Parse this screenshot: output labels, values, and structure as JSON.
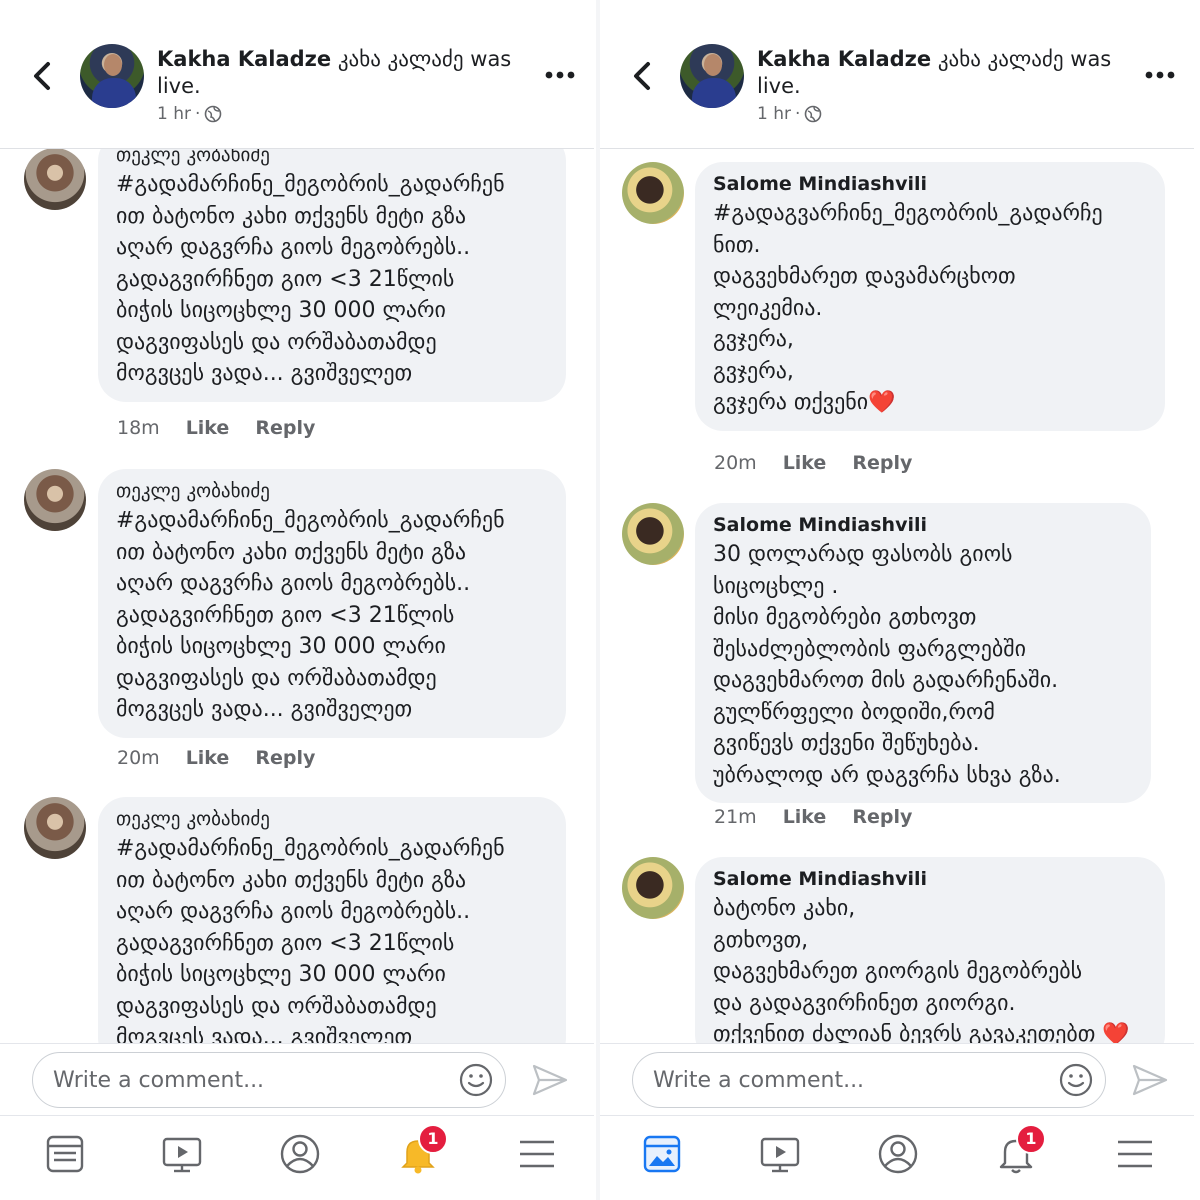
{
  "header": {
    "page_name": "Kakha Kaladze",
    "page_name_alt": "კახა კალაძე",
    "status": "was live.",
    "time": "1 hr",
    "separator": "·"
  },
  "left_comments": [
    {
      "author": "თეკლე კობახიძე",
      "text": "#გადამარჩინე_მეგობრის_გადარჩენ\nით ბატონო კახი თქვენს მეტი გზა\nაღარ დაგვრჩა გიოს მეგობრებს..\nგადაგვირჩნეთ გიო <3 21წლის\nბიჭის სიცოცხლე 30 000 ლარი\nდაგვიფასეს და ორშაბათამდე\nმოგვცეს ვადა... გვიშველეთ",
      "time": "18m",
      "like": "Like",
      "reply": "Reply"
    },
    {
      "author": "თეკლე კობახიძე",
      "text": "#გადამარჩინე_მეგობრის_გადარჩენ\nით ბატონო კახი თქვენს მეტი გზა\nაღარ დაგვრჩა გიოს მეგობრებს..\nგადაგვირჩნეთ გიო <3 21წლის\nბიჭის სიცოცხლე 30 000 ლარი\nდაგვიფასეს და ორშაბათამდე\nმოგვცეს ვადა... გვიშველეთ",
      "time": "20m",
      "like": "Like",
      "reply": "Reply"
    },
    {
      "author": "თეკლე კობახიძე",
      "text": "#გადამარჩინე_მეგობრის_გადარჩენ\nით ბატონო კახი თქვენს მეტი გზა\nაღარ დაგვრჩა გიოს მეგობრებს..\nგადაგვირჩნეთ გიო <3 21წლის\nბიჭის სიცოცხლე 30 000 ლარი\nდაგვიფასეს და ორშაბათამდე\nმოგვცეს ვადა... გვიშველეთ"
    }
  ],
  "right_comments": [
    {
      "author": "Salome Mindiashvili",
      "text": "#გადაგვარჩინე_მეგობრის_გადარჩე\nნით.\nდაგვეხმარეთ დავამარცხოთ\nლეიკემია.\nგვჯერა,\nგვჯერა,\nგვჯერა თქვენი❤️",
      "time": "20m",
      "like": "Like",
      "reply": "Reply"
    },
    {
      "author": "Salome Mindiashvili",
      "text": "30 დოლარად ფასობს გიოს\nსიცოცხლე .\nმისი მეგობრები გთხოვთ\nშესაძლებლობის ფარგლებში\nდაგვეხმაროთ მის გადარჩენაში.\nგულწრფელი ბოდიში,რომ\nგვიწევს თქვენი შეწუხება.\nუბრალოდ არ დაგვრჩა სხვა გზა.",
      "time": "21m",
      "like": "Like",
      "reply": "Reply"
    },
    {
      "author": "Salome Mindiashvili",
      "text": "ბატონო კახი,\nგთხოვთ,\nდაგვეხმარეთ გიორგის მეგობრებს\nდა გადაგვირჩინეთ გიორგი.\nთქვენით ძალიან ბევრს გავაკეთებთ ❤️"
    }
  ],
  "composer": {
    "placeholder": "Write a comment..."
  },
  "nav": {
    "badge": "1"
  },
  "icons": {
    "back": "chevron-left-icon",
    "more": "more-horizontal-icon",
    "globe": "globe-icon",
    "emoji": "smiley-icon",
    "send": "send-icon",
    "news_feed": "news-feed-icon",
    "watch": "video-play-icon",
    "profile": "profile-icon",
    "notifications": "bell-icon",
    "menu": "menu-icon"
  },
  "colors": {
    "accent": "#1877f2",
    "badge": "#e41e3f",
    "bubble": "#f0f2f5",
    "secondary_text": "#65676b"
  }
}
